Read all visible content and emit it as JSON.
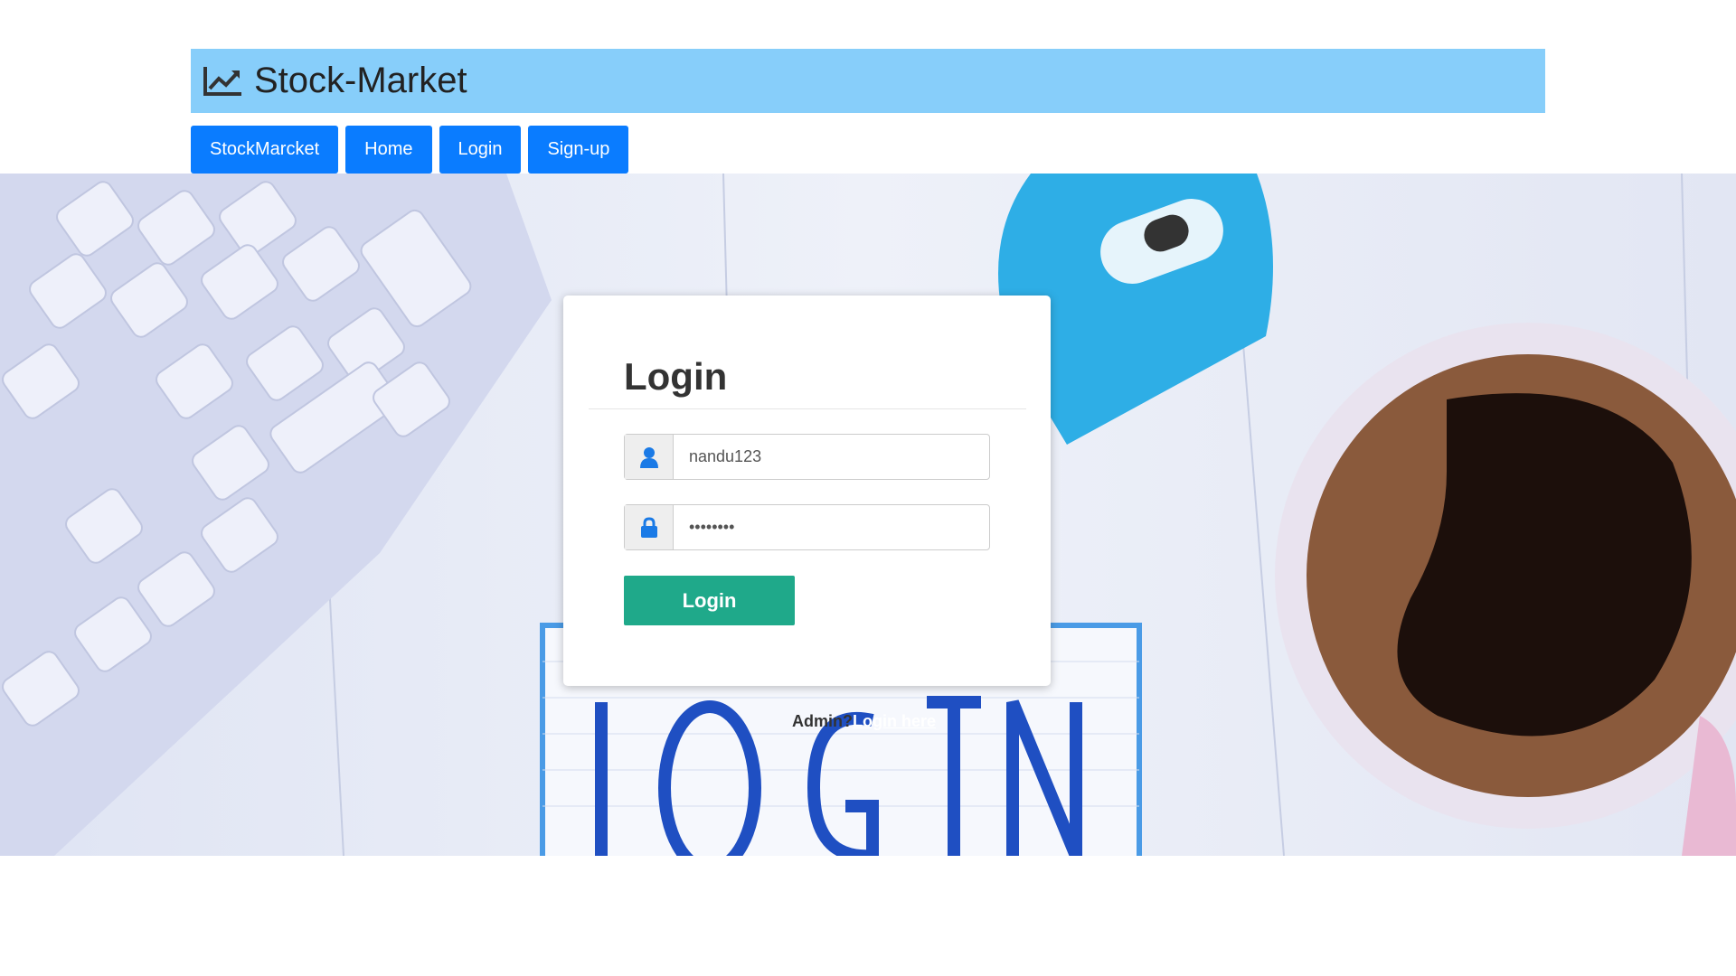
{
  "header": {
    "title": "Stock-Market",
    "icon": "line-chart-icon"
  },
  "nav": {
    "items": [
      {
        "label": "StockMarcket"
      },
      {
        "label": "Home"
      },
      {
        "label": "Login"
      },
      {
        "label": "Sign-up"
      }
    ]
  },
  "login_form": {
    "title": "Login",
    "username": {
      "value": "nandu123",
      "icon": "user-icon"
    },
    "password": {
      "value": "••••••••",
      "icon": "lock-icon"
    },
    "submit_label": "Login"
  },
  "admin": {
    "prompt": "Admin?",
    "link_label": "Login here"
  },
  "colors": {
    "header_bg": "#87cefa",
    "nav_button": "#0a7cff",
    "submit_button": "#1fa98a",
    "icon_blue": "#1a7ae6"
  }
}
